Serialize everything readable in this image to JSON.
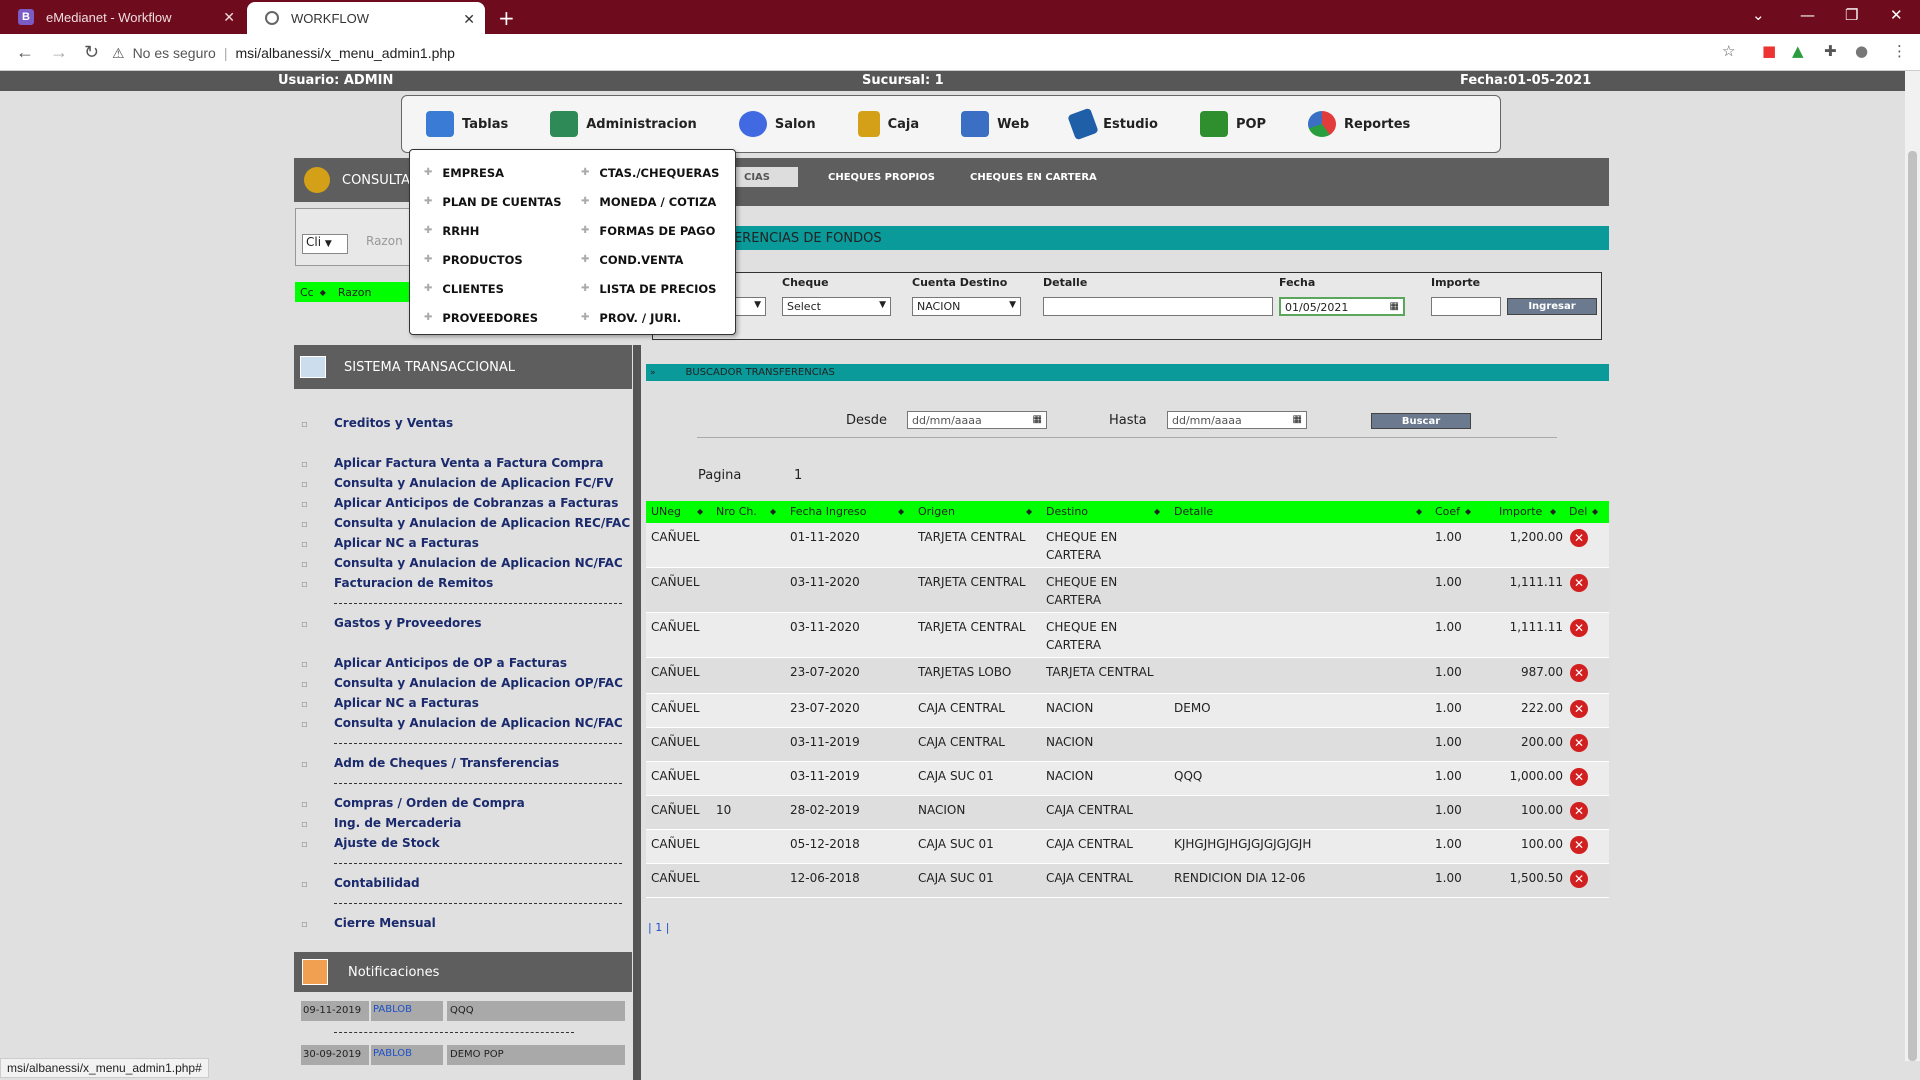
{
  "browser": {
    "tabs": [
      {
        "title": "eMedianet - Workflow",
        "favicon": "B"
      },
      {
        "title": "WORKFLOW"
      }
    ],
    "new_tab": "+",
    "url_warning": "No es seguro",
    "url": "msi/albanessi/x_menu_admin1.php"
  },
  "info": {
    "usuario": "Usuario: ADMIN",
    "sucursal": "Sucursal: 1",
    "fecha": "Fecha:01-05-2021"
  },
  "menu": {
    "items": [
      {
        "label": "Tablas",
        "color": "#3a7bd5"
      },
      {
        "label": "Administracion",
        "color": "#2e8b57"
      },
      {
        "label": "Salon",
        "color": "#4169e1"
      },
      {
        "label": "Caja",
        "color": "#d4a017"
      },
      {
        "label": "Web",
        "color": "#3a6fc4"
      },
      {
        "label": "Estudio",
        "color": "#1f5fa8"
      },
      {
        "label": "POP",
        "color": "#2f8f2f"
      },
      {
        "label": "Reportes",
        "color": "#e23b3b"
      }
    ]
  },
  "dropdown": {
    "col1": [
      "EMPRESA",
      "PLAN DE CUENTAS",
      "RRHH",
      "PRODUCTOS",
      "CLIENTES",
      "PROVEEDORES"
    ],
    "col2": [
      "CTAS./CHEQUERAS",
      "MONEDA / COTIZA",
      "FORMAS DE PAGO",
      "COND.VENTA",
      "LISTA DE PRECIOS",
      "PROV. / JURI."
    ]
  },
  "left": {
    "consulta": "CONSULTA",
    "cli": "Cli",
    "razon_placeholder": "Razon",
    "cc": "Cc",
    "razon_col": "Razon",
    "sistema": "SISTEMA TRANSACCIONAL",
    "links": [
      "Creditos y Ventas",
      "Aplicar Factura Venta a Factura Compra",
      "Consulta y Anulacion de Aplicacion FC/FV",
      "Aplicar Anticipos de Cobranzas a Facturas",
      "Consulta y Anulacion de Aplicacion REC/FAC",
      "Aplicar NC a Facturas",
      "Consulta y Anulacion de Aplicacion NC/FAC",
      "Facturacion de Remitos",
      "Gastos y Proveedores",
      "Aplicar Anticipos de OP a Facturas",
      "Consulta y Anulacion de Aplicacion OP/FAC",
      "Aplicar NC a Facturas",
      "Consulta y Anulacion de Aplicacion NC/FAC",
      "Adm de Cheques / Transferencias",
      "Compras / Orden de Compra",
      "Ing. de Mercaderia",
      "Ajuste de Stock",
      "Contabilidad",
      "Cierre Mensual"
    ],
    "notificaciones": "Notificaciones",
    "notifs": [
      {
        "fecha": "09-11-2019",
        "user": "PABLOB",
        "msg": "QQQ"
      },
      {
        "fecha": "30-09-2019",
        "user": "PABLOB",
        "msg": "DEMO POP"
      }
    ]
  },
  "status_url": "msi/albanessi/x_menu_admin1.php#",
  "right": {
    "subtabs": [
      "CIAS",
      "CHEQUES PROPIOS",
      "CHEQUES EN CARTERA"
    ],
    "trans_title": "TERENCIAS DE FONDOS",
    "form": {
      "cheque": "Cheque",
      "cheque_val": "Select",
      "cuenta": "Cuenta Destino",
      "cuenta_val": "NACION",
      "detalle": "Detalle",
      "fecha": "Fecha",
      "fecha_val": "01/05/2021",
      "importe": "Importe",
      "ingresar": "Ingresar"
    },
    "buscador": "BUSCADOR TRANSFERENCIAS",
    "desde": "Desde",
    "hasta": "Hasta",
    "date_placeholder": "dd/mm/aaaa",
    "buscar": "Buscar",
    "pagina": "Pagina",
    "pagina_num": "1",
    "columns": [
      "UNeg",
      "Nro Ch.",
      "Fecha Ingreso",
      "Origen",
      "Destino",
      "Detalle",
      "Coef",
      "Importe",
      "Del"
    ],
    "rows": [
      {
        "uneg": "CAÑUEL",
        "nro": "",
        "fecha": "01-11-2020",
        "origen": "TARJETA CENTRAL",
        "destino": "CHEQUE EN",
        "destino2": "CARTERA",
        "detalle": "",
        "coef": "1.00",
        "importe": "1,200.00"
      },
      {
        "uneg": "CAÑUEL",
        "nro": "",
        "fecha": "03-11-2020",
        "origen": "TARJETA CENTRAL",
        "destino": "CHEQUE EN",
        "destino2": "CARTERA",
        "detalle": "",
        "coef": "1.00",
        "importe": "1,111.11"
      },
      {
        "uneg": "CAÑUEL",
        "nro": "",
        "fecha": "03-11-2020",
        "origen": "TARJETA CENTRAL",
        "destino": "CHEQUE EN",
        "destino2": "CARTERA",
        "detalle": "",
        "coef": "1.00",
        "importe": "1,111.11"
      },
      {
        "uneg": "CAÑUEL",
        "nro": "",
        "fecha": "23-07-2020",
        "origen": "TARJETAS LOBO",
        "destino": "TARJETA CENTRAL",
        "destino2": "",
        "detalle": "",
        "coef": "1.00",
        "importe": "987.00"
      },
      {
        "uneg": "CAÑUEL",
        "nro": "",
        "fecha": "23-07-2020",
        "origen": "CAJA CENTRAL",
        "destino": "NACION",
        "destino2": "",
        "detalle": "DEMO",
        "coef": "1.00",
        "importe": "222.00"
      },
      {
        "uneg": "CAÑUEL",
        "nro": "",
        "fecha": "03-11-2019",
        "origen": "CAJA CENTRAL",
        "destino": "NACION",
        "destino2": "",
        "detalle": "",
        "coef": "1.00",
        "importe": "200.00"
      },
      {
        "uneg": "CAÑUEL",
        "nro": "",
        "fecha": "03-11-2019",
        "origen": "CAJA SUC 01",
        "destino": "NACION",
        "destino2": "",
        "detalle": "QQQ",
        "coef": "1.00",
        "importe": "1,000.00"
      },
      {
        "uneg": "CAÑUEL",
        "nro": "10",
        "fecha": "28-02-2019",
        "origen": "NACION",
        "destino": "CAJA CENTRAL",
        "destino2": "",
        "detalle": "",
        "coef": "1.00",
        "importe": "100.00"
      },
      {
        "uneg": "CAÑUEL",
        "nro": "",
        "fecha": "05-12-2018",
        "origen": "CAJA SUC 01",
        "destino": "CAJA CENTRAL",
        "destino2": "",
        "detalle": "KJHGJHGJHGJGJGJGJGJH",
        "coef": "1.00",
        "importe": "100.00"
      },
      {
        "uneg": "CAÑUEL",
        "nro": "",
        "fecha": "12-06-2018",
        "origen": "CAJA SUC 01",
        "destino": "CAJA CENTRAL",
        "destino2": "",
        "detalle": "RENDICION DIA 12-06",
        "coef": "1.00",
        "importe": "1,500.50"
      }
    ],
    "pager": "| 1 |"
  }
}
